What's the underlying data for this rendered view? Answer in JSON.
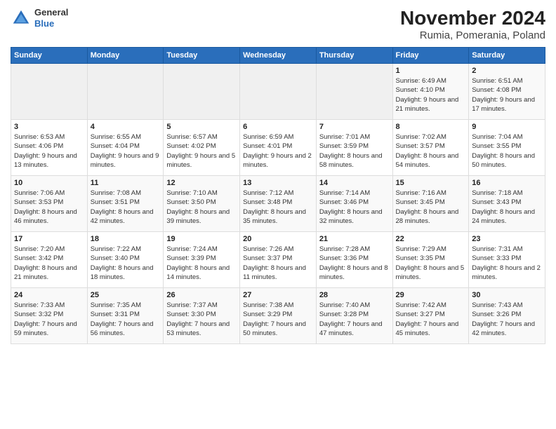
{
  "logo": {
    "general": "General",
    "blue": "Blue"
  },
  "title": "November 2024",
  "subtitle": "Rumia, Pomerania, Poland",
  "weekdays": [
    "Sunday",
    "Monday",
    "Tuesday",
    "Wednesday",
    "Thursday",
    "Friday",
    "Saturday"
  ],
  "weeks": [
    [
      {
        "day": "",
        "info": ""
      },
      {
        "day": "",
        "info": ""
      },
      {
        "day": "",
        "info": ""
      },
      {
        "day": "",
        "info": ""
      },
      {
        "day": "",
        "info": ""
      },
      {
        "day": "1",
        "info": "Sunrise: 6:49 AM\nSunset: 4:10 PM\nDaylight: 9 hours and 21 minutes."
      },
      {
        "day": "2",
        "info": "Sunrise: 6:51 AM\nSunset: 4:08 PM\nDaylight: 9 hours and 17 minutes."
      }
    ],
    [
      {
        "day": "3",
        "info": "Sunrise: 6:53 AM\nSunset: 4:06 PM\nDaylight: 9 hours and 13 minutes."
      },
      {
        "day": "4",
        "info": "Sunrise: 6:55 AM\nSunset: 4:04 PM\nDaylight: 9 hours and 9 minutes."
      },
      {
        "day": "5",
        "info": "Sunrise: 6:57 AM\nSunset: 4:02 PM\nDaylight: 9 hours and 5 minutes."
      },
      {
        "day": "6",
        "info": "Sunrise: 6:59 AM\nSunset: 4:01 PM\nDaylight: 9 hours and 2 minutes."
      },
      {
        "day": "7",
        "info": "Sunrise: 7:01 AM\nSunset: 3:59 PM\nDaylight: 8 hours and 58 minutes."
      },
      {
        "day": "8",
        "info": "Sunrise: 7:02 AM\nSunset: 3:57 PM\nDaylight: 8 hours and 54 minutes."
      },
      {
        "day": "9",
        "info": "Sunrise: 7:04 AM\nSunset: 3:55 PM\nDaylight: 8 hours and 50 minutes."
      }
    ],
    [
      {
        "day": "10",
        "info": "Sunrise: 7:06 AM\nSunset: 3:53 PM\nDaylight: 8 hours and 46 minutes."
      },
      {
        "day": "11",
        "info": "Sunrise: 7:08 AM\nSunset: 3:51 PM\nDaylight: 8 hours and 42 minutes."
      },
      {
        "day": "12",
        "info": "Sunrise: 7:10 AM\nSunset: 3:50 PM\nDaylight: 8 hours and 39 minutes."
      },
      {
        "day": "13",
        "info": "Sunrise: 7:12 AM\nSunset: 3:48 PM\nDaylight: 8 hours and 35 minutes."
      },
      {
        "day": "14",
        "info": "Sunrise: 7:14 AM\nSunset: 3:46 PM\nDaylight: 8 hours and 32 minutes."
      },
      {
        "day": "15",
        "info": "Sunrise: 7:16 AM\nSunset: 3:45 PM\nDaylight: 8 hours and 28 minutes."
      },
      {
        "day": "16",
        "info": "Sunrise: 7:18 AM\nSunset: 3:43 PM\nDaylight: 8 hours and 24 minutes."
      }
    ],
    [
      {
        "day": "17",
        "info": "Sunrise: 7:20 AM\nSunset: 3:42 PM\nDaylight: 8 hours and 21 minutes."
      },
      {
        "day": "18",
        "info": "Sunrise: 7:22 AM\nSunset: 3:40 PM\nDaylight: 8 hours and 18 minutes."
      },
      {
        "day": "19",
        "info": "Sunrise: 7:24 AM\nSunset: 3:39 PM\nDaylight: 8 hours and 14 minutes."
      },
      {
        "day": "20",
        "info": "Sunrise: 7:26 AM\nSunset: 3:37 PM\nDaylight: 8 hours and 11 minutes."
      },
      {
        "day": "21",
        "info": "Sunrise: 7:28 AM\nSunset: 3:36 PM\nDaylight: 8 hours and 8 minutes."
      },
      {
        "day": "22",
        "info": "Sunrise: 7:29 AM\nSunset: 3:35 PM\nDaylight: 8 hours and 5 minutes."
      },
      {
        "day": "23",
        "info": "Sunrise: 7:31 AM\nSunset: 3:33 PM\nDaylight: 8 hours and 2 minutes."
      }
    ],
    [
      {
        "day": "24",
        "info": "Sunrise: 7:33 AM\nSunset: 3:32 PM\nDaylight: 7 hours and 59 minutes."
      },
      {
        "day": "25",
        "info": "Sunrise: 7:35 AM\nSunset: 3:31 PM\nDaylight: 7 hours and 56 minutes."
      },
      {
        "day": "26",
        "info": "Sunrise: 7:37 AM\nSunset: 3:30 PM\nDaylight: 7 hours and 53 minutes."
      },
      {
        "day": "27",
        "info": "Sunrise: 7:38 AM\nSunset: 3:29 PM\nDaylight: 7 hours and 50 minutes."
      },
      {
        "day": "28",
        "info": "Sunrise: 7:40 AM\nSunset: 3:28 PM\nDaylight: 7 hours and 47 minutes."
      },
      {
        "day": "29",
        "info": "Sunrise: 7:42 AM\nSunset: 3:27 PM\nDaylight: 7 hours and 45 minutes."
      },
      {
        "day": "30",
        "info": "Sunrise: 7:43 AM\nSunset: 3:26 PM\nDaylight: 7 hours and 42 minutes."
      }
    ]
  ]
}
